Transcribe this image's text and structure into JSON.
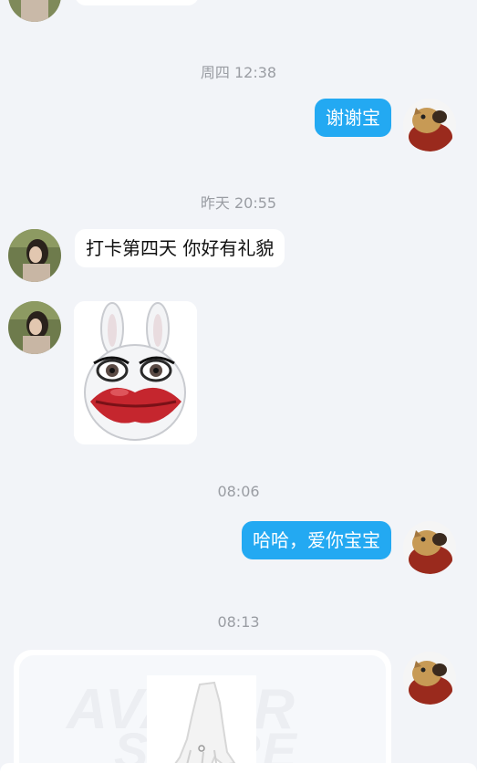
{
  "messages": {
    "ts1": "周四 12:38",
    "m1": "谢谢宝",
    "ts2": "昨天 20:55",
    "m2": "打卡第四天 你好有礼貌",
    "ts3": "08:06",
    "m3": "哈哈，爱你宝宝",
    "ts4": "08:13"
  },
  "card": {
    "watermark_line1": "AVATAR",
    "watermark_line2": "STORE"
  },
  "colors": {
    "background": "#f2f4f8",
    "outgoing_bubble": "#23a9f2",
    "incoming_bubble": "#ffffff",
    "timestamp_text": "#9a9da3"
  },
  "icons": {
    "contact_avatar": "girl-photo-avatar",
    "self_avatar": "dog-photo-avatar",
    "sticker": "rabbit-big-lips-sticker"
  }
}
